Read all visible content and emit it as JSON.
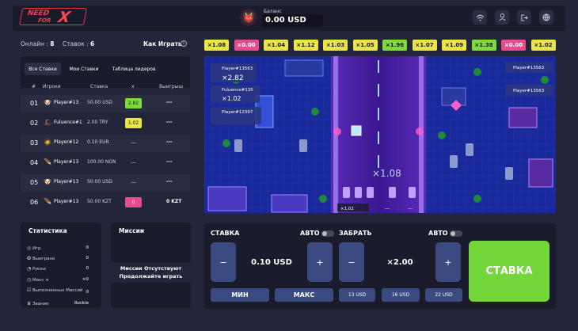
{
  "header": {
    "logo_part1": "NEED",
    "logo_part2": "FOR",
    "logo_part3": "X",
    "balance_label": "Баланс",
    "balance_value": "0.00 USD"
  },
  "info": {
    "online_label": "Онлайн :",
    "online_value": "8",
    "bets_label": "Ставок :",
    "bets_value": "6",
    "how_to_play": "Как Играть"
  },
  "tabs": [
    "Все Ставки",
    "Мои Ставки",
    "Таблица лидеров"
  ],
  "table": {
    "headers": [
      "#",
      "Игроки",
      "Ставка",
      "x",
      "Выигрыш"
    ],
    "rows": [
      {
        "num": "01",
        "avatar": "🐶",
        "player": "Player#13",
        "bet": "50.00 USD",
        "mult": "2.82",
        "mult_color": "#7edc3a",
        "win": "---"
      },
      {
        "num": "02",
        "avatar": "🎩",
        "player": "Fuluence#1",
        "bet": "2.00 TRY",
        "mult": "1.02",
        "mult_color": "#e9e646",
        "win": "---"
      },
      {
        "num": "03",
        "avatar": "🧔",
        "player": "Player#12",
        "bet": "0.10 EUR",
        "mult": "---",
        "mult_color": "",
        "win": "---"
      },
      {
        "num": "04",
        "avatar": "🪶",
        "player": "Player#13",
        "bet": "100.00 NGN",
        "mult": "---",
        "mult_color": "",
        "win": "---"
      },
      {
        "num": "05",
        "avatar": "🐶",
        "player": "Player#13",
        "bet": "50.00 USD",
        "mult": "---",
        "mult_color": "",
        "win": "---"
      },
      {
        "num": "06",
        "avatar": "🪶",
        "player": "Player#13",
        "bet": "50.00 KZT",
        "mult": "0",
        "mult_color": "#e84b8a",
        "win": "0 KZT"
      }
    ]
  },
  "stats": {
    "title": "Статистика",
    "items": [
      {
        "label": "Игр",
        "value": "0"
      },
      {
        "label": "Выиграно",
        "value": "0"
      },
      {
        "label": "Риски",
        "value": "0"
      },
      {
        "label": "Макс ×",
        "value": "×0"
      },
      {
        "label": "Выполненных Миссий",
        "value": "0"
      },
      {
        "label": "Звание",
        "value": "Rockie"
      }
    ]
  },
  "missions": {
    "title": "Миссии",
    "empty_line1": "Миссии Отсутствуют",
    "empty_line2": "Продолжайте играть"
  },
  "multipliers": [
    {
      "v": "×1.08",
      "c": "y"
    },
    {
      "v": "×0.00",
      "c": "p"
    },
    {
      "v": "×1.04",
      "c": "y"
    },
    {
      "v": "×1.12",
      "c": "y"
    },
    {
      "v": "×1.03",
      "c": "y"
    },
    {
      "v": "×1.05",
      "c": "y"
    },
    {
      "v": "×1.96",
      "c": "g"
    },
    {
      "v": "×1.07",
      "c": "y"
    },
    {
      "v": "×1.09",
      "c": "y"
    },
    {
      "v": "×1.38",
      "c": "g"
    },
    {
      "v": "×0.00",
      "c": "p"
    },
    {
      "v": "×1.02",
      "c": "y"
    }
  ],
  "game": {
    "current_multiplier": "×1.08",
    "tag1_name": "Player#13563",
    "tag1_mult": "×2.82",
    "tag2_name": "Fuluence#135",
    "tag2_mult": "×1.02",
    "tag3_name": "Player#12397",
    "tag4_name": "Player#13563",
    "tag5_name": "Player#13563",
    "lane_mult": "×1.02",
    "lane_dash1": "---",
    "lane_dash2": "---"
  },
  "controls": {
    "bet_label": "СТАВКА",
    "auto_label": "АВТО",
    "cashout_label": "ЗАБРАТЬ",
    "auto_label2": "АВТО",
    "bet_value": "0.10 USD",
    "cashout_value": "×2.00",
    "minus": "−",
    "plus": "+",
    "min_label": "МИН",
    "max_label": "МАКС",
    "quick": [
      "13 USD",
      "16 USD",
      "22 USD"
    ],
    "main_button": "СТАВКА"
  }
}
